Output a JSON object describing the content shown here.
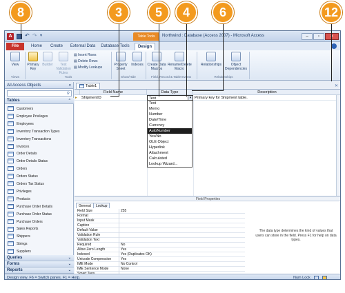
{
  "callouts": [
    "8",
    "3",
    "5",
    "4",
    "6",
    "12"
  ],
  "window": {
    "title": "Northwind : Database (Access 2007) - Microsoft Access",
    "context_tab_group": "Table Tools"
  },
  "ribbon": {
    "tabs": [
      "File",
      "Home",
      "Create",
      "External Data",
      "Database Tools",
      "Design"
    ],
    "active_tab": "Design",
    "buttons": {
      "view": "View",
      "primary_key": "Primary Key",
      "builder": "Builder",
      "test_validation": "Test Validation Rules",
      "insert_rows": "Insert Rows",
      "delete_rows": "Delete Rows",
      "modify_lookups": "Modify Lookups",
      "property_sheet": "Property Sheet",
      "indexes": "Indexes",
      "create_data_macros": "Create Data Macros",
      "rename_delete_macro": "Rename/Delete Macro",
      "relationships": "Relationships",
      "object_dependencies": "Object Dependencies"
    },
    "groups": [
      "Views",
      "Tools",
      "Show/Hide",
      "Field, Record & Table Events",
      "Relationships"
    ]
  },
  "nav": {
    "header": "All Access Objects",
    "group_tables": "Tables",
    "tables": [
      "Customers",
      "Employee Privileges",
      "Employees",
      "Inventory Transaction Types",
      "Inventory Transactions",
      "Invoices",
      "Order Details",
      "Order Details Status",
      "Orders",
      "Orders Status",
      "Orders Tax Status",
      "Privileges",
      "Products",
      "Purchase Order Details",
      "Purchase Order Status",
      "Purchase Orders",
      "Sales Reports",
      "Shippers",
      "Strings",
      "Suppliers"
    ],
    "group_queries": "Queries",
    "group_forms": "Forms",
    "group_reports": "Reports"
  },
  "document": {
    "tab": "Table1",
    "headers": {
      "field_name": "Field Name",
      "data_type": "Data Type",
      "description": "Description"
    },
    "row": {
      "field_name": "ShipmentID",
      "data_type": "Text",
      "description": "Primary key for Shipment table."
    }
  },
  "dropdown": {
    "options": [
      "Text",
      "Memo",
      "Number",
      "Date/Time",
      "Currency",
      "AutoNumber",
      "Yes/No",
      "OLE Object",
      "Hyperlink",
      "Attachment",
      "Calculated",
      "Lookup Wizard..."
    ],
    "selected": "AutoNumber"
  },
  "field_properties": {
    "title": "Field Properties",
    "tabs": [
      "General",
      "Lookup"
    ],
    "rows": [
      {
        "name": "Field Size",
        "value": "255"
      },
      {
        "name": "Format",
        "value": ""
      },
      {
        "name": "Input Mask",
        "value": ""
      },
      {
        "name": "Caption",
        "value": ""
      },
      {
        "name": "Default Value",
        "value": ""
      },
      {
        "name": "Validation Rule",
        "value": ""
      },
      {
        "name": "Validation Text",
        "value": ""
      },
      {
        "name": "Required",
        "value": "No"
      },
      {
        "name": "Allow Zero Length",
        "value": "Yes"
      },
      {
        "name": "Indexed",
        "value": "Yes (Duplicates OK)"
      },
      {
        "name": "Unicode Compression",
        "value": "Yes"
      },
      {
        "name": "IME Mode",
        "value": "No Control"
      },
      {
        "name": "IME Sentence Mode",
        "value": "None"
      },
      {
        "name": "Smart Tags",
        "value": ""
      }
    ],
    "help": "The data type determines the kind of values that users can store in the field. Press F1 for help on data types."
  },
  "status": {
    "left": "Design view.  F6 = Switch panes.  F1 = Help.",
    "right": "Num Lock"
  },
  "colors": {
    "callout": "#f39a1e",
    "file_tab": "#c8342c",
    "context_tab": "#e88a26",
    "selection": "#1e1e1e"
  }
}
